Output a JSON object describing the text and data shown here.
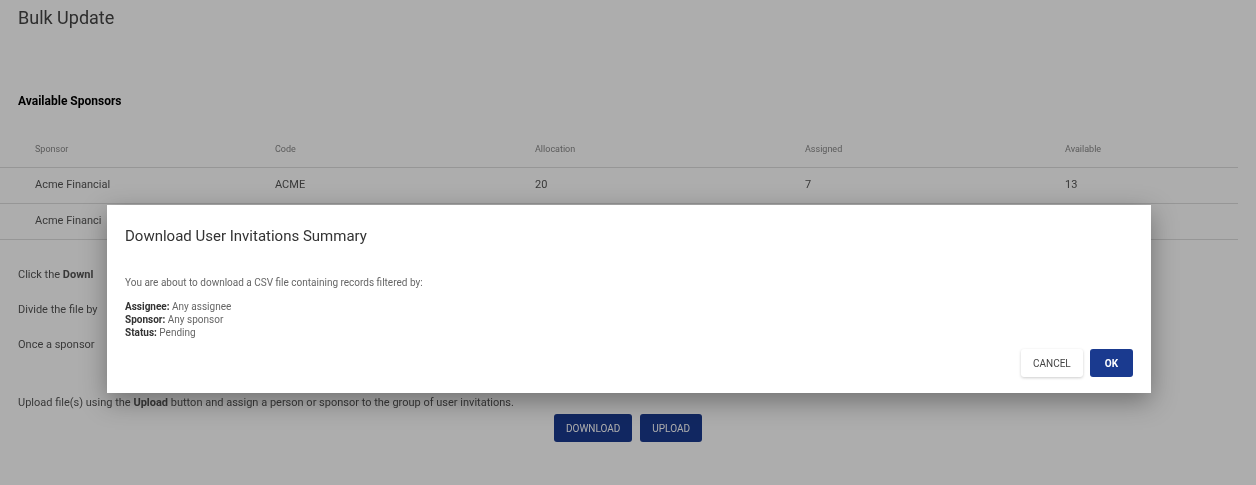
{
  "page": {
    "title": "Bulk Update",
    "section_title": "Available Sponsors"
  },
  "table": {
    "columns": [
      "Sponsor",
      "Code",
      "Allocation",
      "Assigned",
      "Available"
    ],
    "rows": [
      [
        "Acme Financial",
        "ACME",
        "20",
        "7",
        "13"
      ],
      [
        "Acme Financi"
      ]
    ]
  },
  "instructions": [
    "Click the **Downl**",
    "Divide the file by",
    "Once a sponsor",
    "Upload file(s) using the **Upload** button and assign a person or sponsor to the group of user invitations."
  ],
  "actions": [
    "DOWNLOAD",
    "UPLOAD"
  ],
  "dialog": {
    "title": "Download User Invitations Summary",
    "message": "You are about to download a CSV file containing records filtered by:",
    "filters": [
      {
        "label": "Assignee:",
        "value": "Any assignee"
      },
      {
        "label": "Sponsor:",
        "value": "Any sponsor"
      },
      {
        "label": "Status:",
        "value": "Pending"
      }
    ],
    "buttons": [
      {
        "label": "CANCEL",
        "kind": "text"
      },
      {
        "label": "OK",
        "kind": "primary"
      }
    ]
  }
}
